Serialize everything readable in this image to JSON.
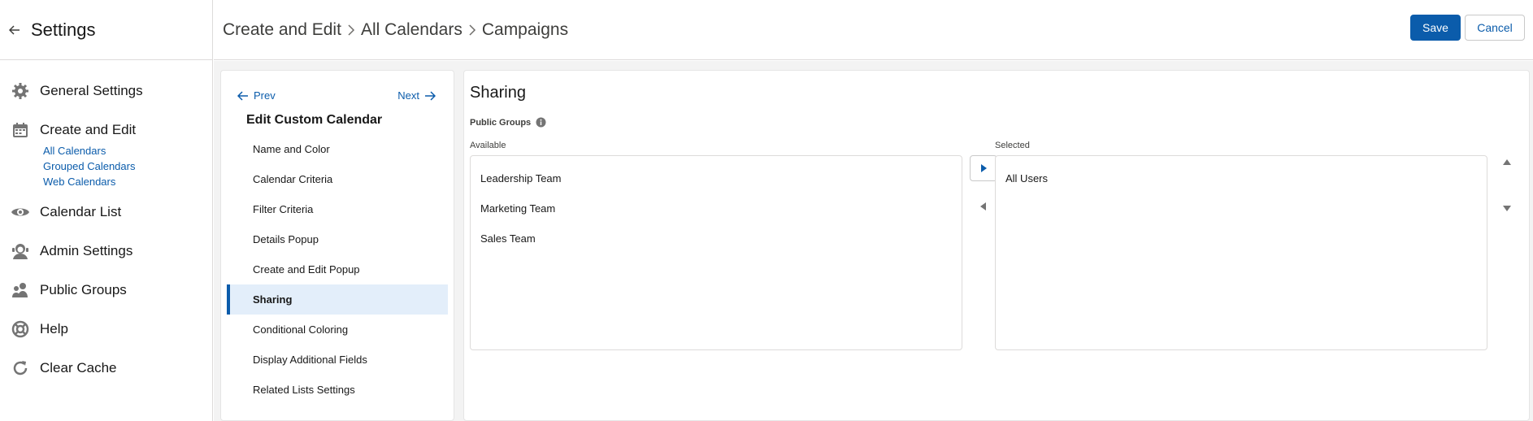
{
  "sidebar": {
    "title": "Settings",
    "items": [
      {
        "label": "General Settings",
        "icon": "gear-icon"
      },
      {
        "label": "Create and Edit",
        "icon": "calendar-icon"
      },
      {
        "label": "Calendar List",
        "icon": "eye-icon"
      },
      {
        "label": "Admin Settings",
        "icon": "user-icon"
      },
      {
        "label": "Public Groups",
        "icon": "groups-icon"
      },
      {
        "label": "Help",
        "icon": "lifebuoy-icon"
      },
      {
        "label": "Clear Cache",
        "icon": "refresh-icon"
      }
    ],
    "subitems": [
      "All Calendars",
      "Grouped Calendars",
      "Web Calendars"
    ]
  },
  "header": {
    "breadcrumbs": [
      "Create and Edit",
      "All Calendars",
      "Campaigns"
    ],
    "save_label": "Save",
    "cancel_label": "Cancel"
  },
  "steps": {
    "prev_label": "Prev",
    "next_label": "Next",
    "title": "Edit Custom Calendar",
    "items": [
      "Name and Color",
      "Calendar Criteria",
      "Filter Criteria",
      "Details Popup",
      "Create and Edit Popup",
      "Sharing",
      "Conditional Coloring",
      "Display Additional Fields",
      "Related Lists Settings"
    ],
    "active": "Sharing"
  },
  "sharing": {
    "title": "Sharing",
    "groups_label": "Public Groups",
    "available_label": "Available",
    "selected_label": "Selected",
    "available": [
      "Leadership Team",
      "Marketing Team",
      "Sales Team"
    ],
    "selected": [
      "All Users"
    ]
  },
  "colors": {
    "brand": "#0b5cab",
    "active_bg": "#e3eefa",
    "page_bg": "#f3f3f3"
  }
}
